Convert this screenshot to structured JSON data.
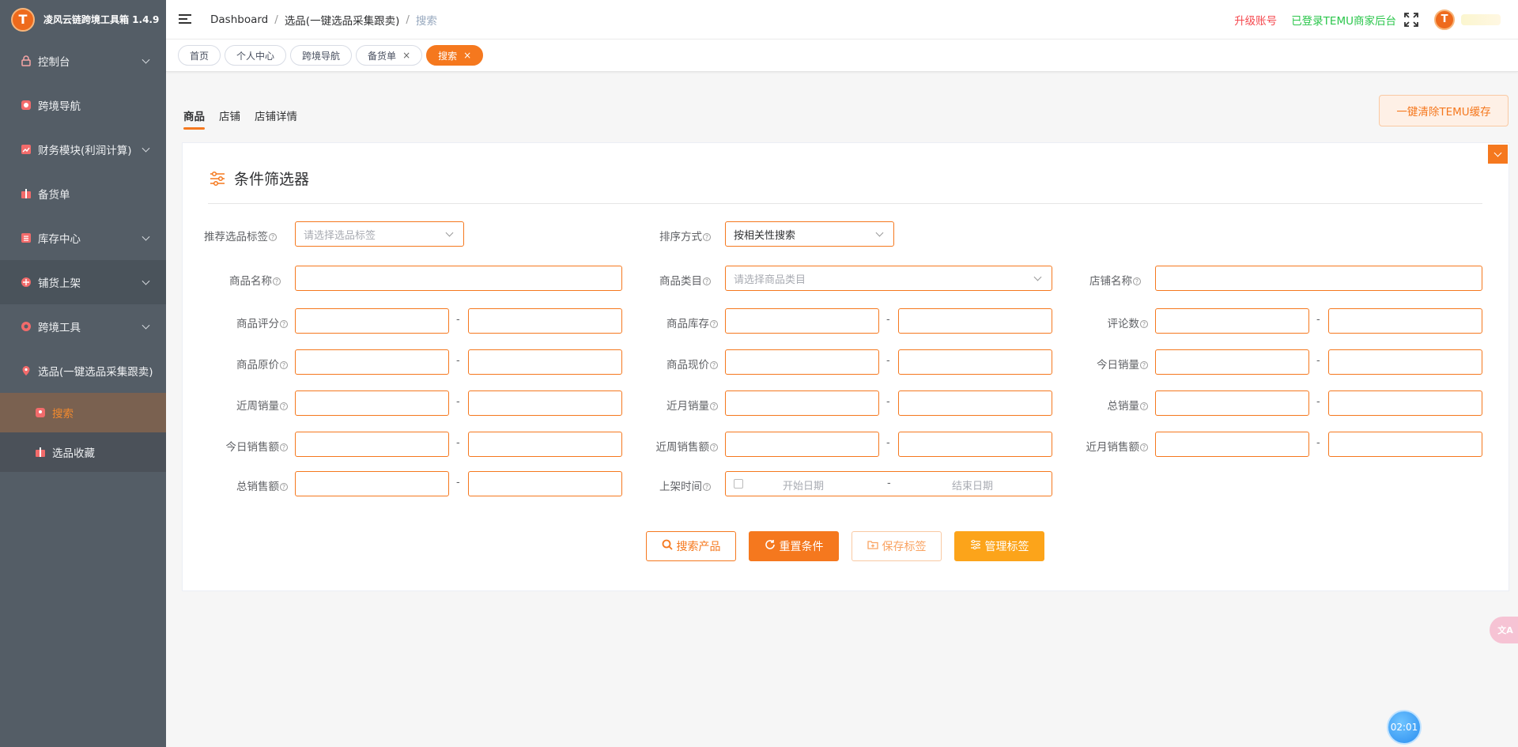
{
  "app": {
    "title": "凌风云链跨境工具箱 1.4.9",
    "logo_letter": "T"
  },
  "sidebar": {
    "items": [
      {
        "label": "控制台",
        "icon": "lock-icon",
        "has_children": true
      },
      {
        "label": "跨境导航",
        "icon": "globe-icon",
        "has_children": false
      },
      {
        "label": "财务模块(利润计算)",
        "icon": "chart-icon",
        "has_children": true
      },
      {
        "label": "备货单",
        "icon": "gift-icon",
        "has_children": false
      },
      {
        "label": "库存中心",
        "icon": "list-icon",
        "has_children": true
      },
      {
        "label": "铺货上架",
        "icon": "shop-icon",
        "has_children": true
      },
      {
        "label": "跨境工具",
        "icon": "lifebuoy-icon",
        "has_children": true
      },
      {
        "label": "选品(一键选品采集跟卖)",
        "icon": "location-icon",
        "has_children": false
      }
    ],
    "sub_items": [
      {
        "label": "搜索",
        "icon": "location-icon",
        "active": true
      },
      {
        "label": "选品收藏",
        "icon": "gift-icon",
        "active": false
      }
    ]
  },
  "header": {
    "breadcrumb": [
      "Dashboard",
      "选品(一键选品采集跟卖)",
      "搜索"
    ],
    "upgrade": "升级账号",
    "temu_status": "已登录TEMU商家后台",
    "avatar_letter": "T"
  },
  "tags": [
    {
      "label": "首页",
      "closable": false,
      "active": false
    },
    {
      "label": "个人中心",
      "closable": false,
      "active": false
    },
    {
      "label": "跨境导航",
      "closable": false,
      "active": false
    },
    {
      "label": "备货单",
      "closable": true,
      "active": false
    },
    {
      "label": "搜索",
      "closable": true,
      "active": true
    }
  ],
  "tag_close": "×",
  "tabs": [
    "商品",
    "店铺",
    "店铺详情"
  ],
  "clear_cache_button": "一键清除TEMU缓存",
  "filter": {
    "title": "条件筛选器",
    "help": "?",
    "recommend_tag": {
      "label": "推荐选品标签",
      "placeholder": "请选择选品标签"
    },
    "sort": {
      "label": "排序方式",
      "value": "按相关性搜索"
    },
    "product_name": {
      "label": "商品名称"
    },
    "category": {
      "label": "商品类目",
      "placeholder": "请选择商品类目"
    },
    "shop_name": {
      "label": "店铺名称"
    },
    "ranges": [
      {
        "label": "商品评分"
      },
      {
        "label": "商品库存"
      },
      {
        "label": "评论数"
      },
      {
        "label": "商品原价"
      },
      {
        "label": "商品现价"
      },
      {
        "label": "今日销量"
      },
      {
        "label": "近周销量"
      },
      {
        "label": "近月销量"
      },
      {
        "label": "总销量"
      },
      {
        "label": "今日销售额"
      },
      {
        "label": "近周销售额"
      },
      {
        "label": "近月销售额"
      },
      {
        "label": "总销售额"
      }
    ],
    "range_sep": "-",
    "listing_time": {
      "label": "上架时间",
      "start": "开始日期",
      "end": "结束日期"
    },
    "buttons": {
      "search": "搜索产品",
      "reset": "重置条件",
      "save": "保存标签",
      "manage": "管理标签"
    }
  },
  "translate_fab": "文A",
  "timer": "02:01",
  "colors": {
    "accent": "#f5781e",
    "sidebar": "#545d66",
    "upgrade": "#f5484e",
    "temu": "#2ac64b",
    "manage": "#fca41a"
  }
}
